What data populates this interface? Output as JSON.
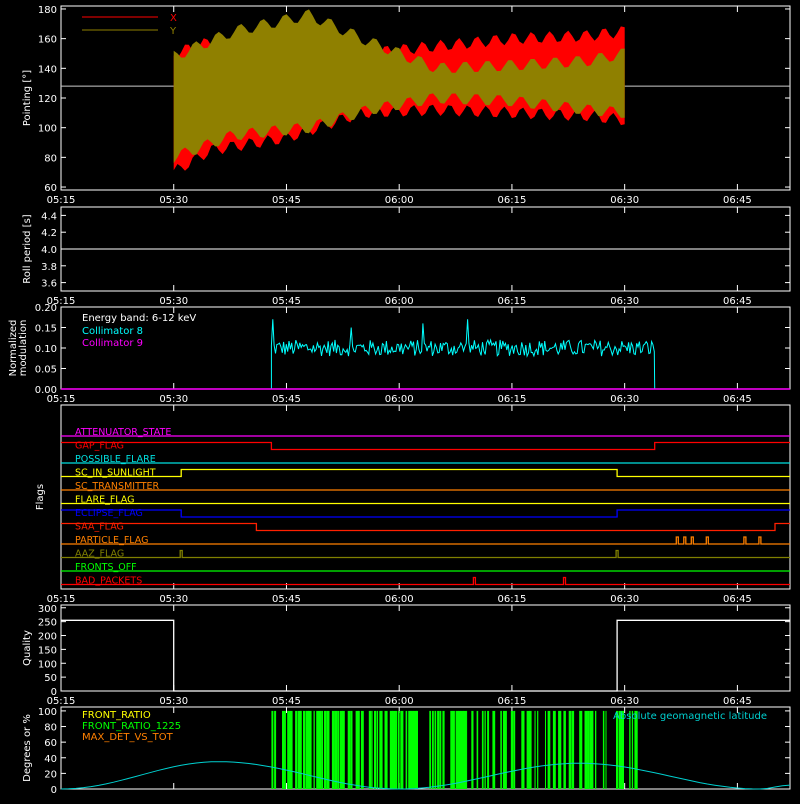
{
  "time_ticks": [
    "05:15",
    "05:30",
    "05:45",
    "06:00",
    "06:15",
    "06:30",
    "06:45"
  ],
  "chart_data": [
    {
      "type": "area",
      "ylabel": "Pointing [°]",
      "ylim": [
        58,
        182
      ],
      "yticks": [
        60,
        80,
        100,
        120,
        140,
        160,
        180
      ],
      "xlim": [
        "05:15",
        "06:52"
      ],
      "reference_line": 128,
      "series": [
        {
          "name": "X",
          "color": "#ff0000",
          "envelope": [
            [
              "05:30",
              70,
              150
            ],
            [
              "05:35",
              85,
              158
            ],
            [
              "05:45",
              93,
              160
            ],
            [
              "05:55",
              110,
              150
            ],
            [
              "06:05",
              112,
              155
            ],
            [
              "06:15",
              110,
              160
            ],
            [
              "06:25",
              108,
              162
            ],
            [
              "06:30",
              105,
              165
            ]
          ]
        },
        {
          "name": "Y",
          "color": "#8f8000",
          "envelope": [
            [
              "05:30",
              80,
              148
            ],
            [
              "05:38",
              95,
              165
            ],
            [
              "05:48",
              100,
              176
            ],
            [
              "05:56",
              112,
              158
            ],
            [
              "06:05",
              120,
              140
            ],
            [
              "06:15",
              118,
              142
            ],
            [
              "06:25",
              112,
              145
            ],
            [
              "06:30",
              110,
              150
            ]
          ]
        }
      ]
    },
    {
      "type": "line",
      "ylabel": "Roll period [s]",
      "ylim": [
        3.5,
        4.5
      ],
      "yticks": [
        3.6,
        3.8,
        4.0,
        4.2,
        4.4
      ],
      "series": [
        {
          "name": "",
          "color": "#ffffff",
          "points": [
            [
              "05:15",
              4.0
            ],
            [
              "06:52",
              4.0
            ]
          ]
        }
      ]
    },
    {
      "type": "line",
      "ylabel": "Normalized modulation",
      "ylim": [
        0,
        0.2
      ],
      "yticks": [
        0.0,
        0.05,
        0.1,
        0.15,
        0.2
      ],
      "annotation": "Energy band: 6-12 keV",
      "series": [
        {
          "name": "Collimator 8",
          "color": "#00ffff",
          "start": "05:43",
          "end": "06:34",
          "level": 0.1,
          "spread": 0.02,
          "peaks": [
            0.17,
            0.15,
            0.16,
            0.17
          ]
        },
        {
          "name": "Collimator 9",
          "color": "#ff00ff",
          "points": [
            [
              "05:15",
              0.0
            ],
            [
              "06:52",
              0.0
            ]
          ]
        }
      ]
    },
    {
      "type": "table",
      "ylabel": "Flags",
      "flags": [
        {
          "name": "ATTENUATOR_STATE",
          "color": "#ff00ff",
          "transitions": []
        },
        {
          "name": "GAP_FLAG",
          "color": "#ff0000",
          "transitions": [
            [
              "05:43",
              "down"
            ],
            [
              "06:34",
              "up"
            ]
          ]
        },
        {
          "name": "POSSIBLE_FLARE",
          "color": "#00e0e0",
          "transitions": []
        },
        {
          "name": "SC_IN_SUNLIGHT",
          "color": "#ffff00",
          "transitions": [
            [
              "05:31",
              "up"
            ],
            [
              "06:29",
              "down"
            ]
          ]
        },
        {
          "name": "SC_TRANSMITTER",
          "color": "#ff8000",
          "transitions": []
        },
        {
          "name": "FLARE_FLAG",
          "color": "#ffff00",
          "transitions": []
        },
        {
          "name": "ECLIPSE_FLAG",
          "color": "#0000ff",
          "transitions": [
            [
              "05:31",
              "down"
            ],
            [
              "06:29",
              "up"
            ]
          ]
        },
        {
          "name": "SAA_FLAG",
          "color": "#ff2000",
          "transitions": [
            [
              "05:41",
              "down"
            ],
            [
              "06:50",
              "up"
            ]
          ]
        },
        {
          "name": "PARTICLE_FLAG",
          "color": "#ff8000",
          "spikes": [
            "06:37",
            "06:38",
            "06:39",
            "06:41",
            "06:46",
            "06:48"
          ]
        },
        {
          "name": "AAZ_FLAG",
          "color": "#808000",
          "spikes": [
            "05:31",
            "06:29"
          ]
        },
        {
          "name": "FRONTS_OFF",
          "color": "#00ff00",
          "transitions": []
        },
        {
          "name": "BAD_PACKETS",
          "color": "#ff0000",
          "spikes": [
            "06:10",
            "06:22"
          ]
        }
      ]
    },
    {
      "type": "line",
      "ylabel": "Quality",
      "ylim": [
        0,
        310
      ],
      "yticks": [
        0,
        50,
        100,
        150,
        200,
        250,
        300
      ],
      "series": [
        {
          "name": "",
          "color": "#ffffff",
          "points": [
            [
              "05:15",
              255
            ],
            [
              "05:30",
              255
            ],
            [
              "05:30",
              0
            ],
            [
              "06:29",
              0
            ],
            [
              "06:29",
              255
            ],
            [
              "06:52",
              255
            ]
          ]
        }
      ]
    },
    {
      "type": "line",
      "ylabel": "Degrees or %",
      "ylim": [
        0,
        105
      ],
      "yticks": [
        0,
        20,
        40,
        60,
        80,
        100
      ],
      "annotation": "Absolute geomagnetic latitude",
      "series": [
        {
          "name": "FRONT_RATIO",
          "color": "#ffff00",
          "points": []
        },
        {
          "name": "FRONT_RATIO_1225",
          "color": "#00ff00",
          "start": "05:43",
          "end": "06:33",
          "level": 100
        },
        {
          "name": "MAX_DET_VS_TOT",
          "color": "#ff8000",
          "points": []
        },
        {
          "name": "",
          "color": "#00d0d0",
          "points": [
            [
              "05:15",
              0
            ],
            [
              "05:36",
              35
            ],
            [
              "06:00",
              0
            ],
            [
              "06:24",
              33
            ],
            [
              "06:48",
              0
            ],
            [
              "06:52",
              5
            ]
          ]
        }
      ]
    }
  ],
  "colors": {
    "axes": "#ffffff",
    "background": "#000000"
  }
}
